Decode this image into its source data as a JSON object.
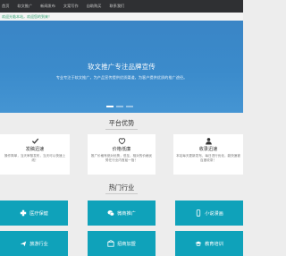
{
  "nav": {
    "items": [
      "首页",
      "软文推广",
      "新闻发布",
      "文案写作",
      "自助购买",
      "联系我们"
    ]
  },
  "notice": "欢迎光临本站，欢迎您的到来！",
  "hero": {
    "title": "软文推广专注品牌宣传",
    "subtitle": "专业专注于软文推广，为产品宣传提供优质渠道，为客户提供优质的推广途径。",
    "slide_count": 3,
    "active_slide": 0
  },
  "advantages": {
    "title": "平台优势",
    "cards": [
      {
        "icon": "checkmark-icon",
        "title": "发稿迅速",
        "desc": "操作简单，当天审核发布，当天可以快速上线！"
      },
      {
        "icon": "heart-icon",
        "title": "价格低廉",
        "desc": "推广价格有绝对优势，低至，相对的价格优势在行业内首屈一指！"
      },
      {
        "icon": "user-icon",
        "title": "收录迅速",
        "desc": "本站每天更新发布，每日进行优化，能快速被百度收录！"
      }
    ]
  },
  "industries": {
    "title": "热门行业",
    "tiles": [
      {
        "icon": "medical-icon",
        "label": "医疗保健"
      },
      {
        "icon": "wechat-icon",
        "label": "微商推广"
      },
      {
        "icon": "mobile-icon",
        "label": "小说漫画"
      },
      {
        "icon": "travel-icon",
        "label": "旅游行业"
      },
      {
        "icon": "franchise-icon",
        "label": "招商加盟"
      },
      {
        "icon": "education-icon",
        "label": "教育培训"
      }
    ]
  },
  "colors": {
    "nav_bg": "#2f3033",
    "hero_bg": "#3b8bcb",
    "tile_bg": "#0fa2ba",
    "notice_text": "#2c9f6e",
    "page_bg": "#ededed"
  }
}
